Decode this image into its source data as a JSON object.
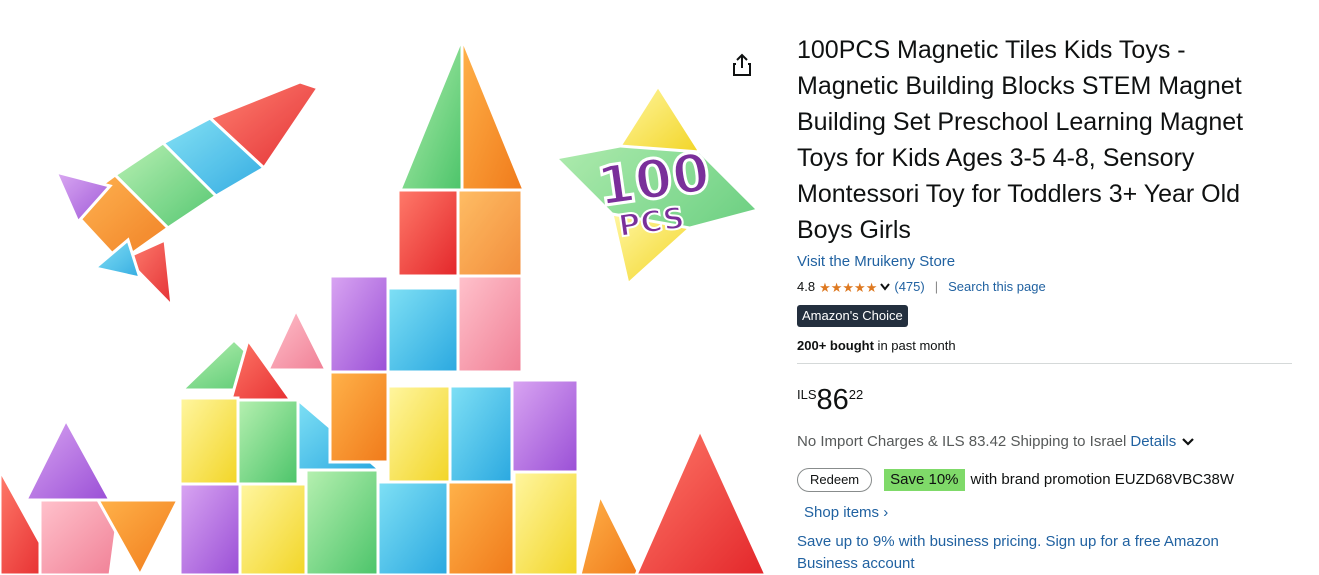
{
  "product": {
    "title": "100PCS Magnetic Tiles Kids Toys - Magnetic Building Blocks STEM Magnet Building Set Preschool Learning Magnet Toys for Kids Ages 3-5 4-8, Sensory Montessori Toy for Toddlers 3+ Year Old Boys Girls",
    "store_link": "Visit the Mruikeny Store",
    "rating": "4.8",
    "stars": 4.8,
    "review_count": "(475)",
    "separator": "|",
    "search_page": "Search this page",
    "badge": "Amazon's Choice",
    "bought_bold": "200+ bought",
    "bought_rest": " in past month"
  },
  "image": {
    "overlay_number": "100",
    "overlay_unit": "PCS"
  },
  "price": {
    "currency": "ILS",
    "whole": "86",
    "fraction": "22"
  },
  "shipping": {
    "text": "No Import Charges & ILS 83.42 Shipping to Israel",
    "details_link": "Details"
  },
  "promotion": {
    "redeem_label": "Redeem",
    "save_label": "Save 10%",
    "promo_text": "with brand promotion EUZD68VBC38W"
  },
  "links": {
    "shop_items": "Shop items ›",
    "business": "Save up to 9% with business pricing. Sign up for a free Amazon Business account"
  },
  "icons": {
    "share": "share-icon",
    "star": "star-icon",
    "chevron": "chevron-down-icon"
  },
  "colors": {
    "link": "#2162a1",
    "star": "#de7921",
    "badge_bg": "#232f3e",
    "save_bg": "#7fda69",
    "text": "#0f1111",
    "muted": "#565959"
  }
}
